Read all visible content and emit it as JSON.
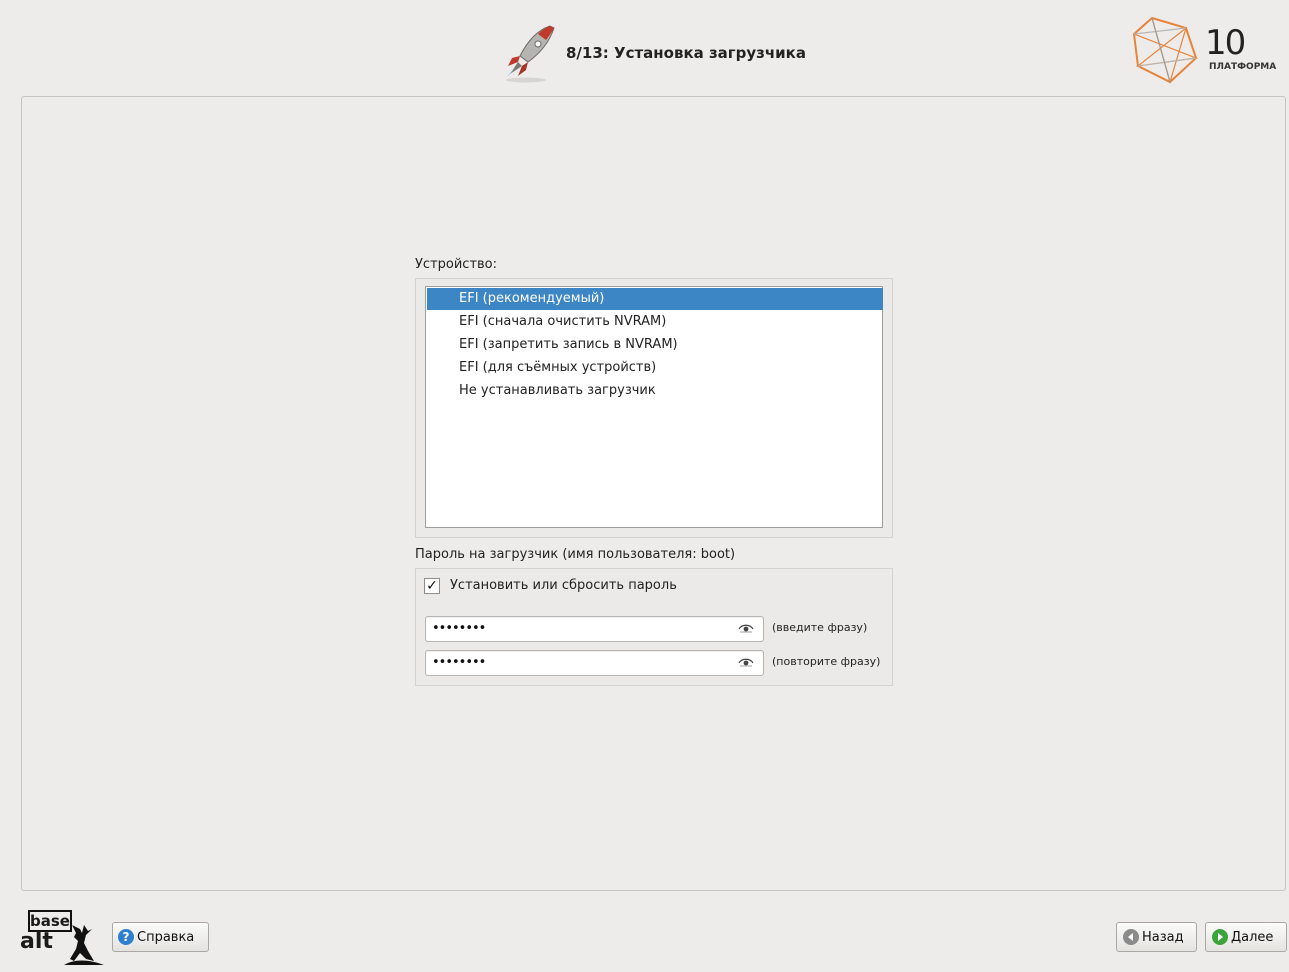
{
  "header": {
    "title": "8/13: Установка загрузчика",
    "logo": {
      "number": "10",
      "word": "ПЛАТФОРМА",
      "accent": "#e8833a"
    }
  },
  "device": {
    "label": "Устройство:",
    "items": [
      {
        "label": "EFI (рекомендуемый)",
        "selected": true
      },
      {
        "label": "EFI (сначала очистить NVRAM)",
        "selected": false
      },
      {
        "label": "EFI (запретить запись в NVRAM)",
        "selected": false
      },
      {
        "label": "EFI (для съёмных устройств)",
        "selected": false
      },
      {
        "label": "Не устанавливать загрузчик",
        "selected": false
      }
    ]
  },
  "password": {
    "label": "Пароль на загрузчик (имя пользователя: boot)",
    "checkbox_label": "Установить или сбросить пароль",
    "checkbox_checked": true,
    "checkmark": "✓",
    "field1": {
      "value": "••••••••",
      "hint": "(введите фразу)"
    },
    "field2": {
      "value": "••••••••",
      "hint": "(повторите фразу)"
    }
  },
  "footer": {
    "brand_top": "base",
    "brand_bottom": "alt",
    "help_label": "Справка",
    "back_label": "Назад",
    "next_label": "Далее"
  },
  "colors": {
    "selection": "#3d86c6",
    "help_icon": "#2f7fd1",
    "back_icon": "#8a8a8a",
    "next_icon": "#3ca43c"
  }
}
